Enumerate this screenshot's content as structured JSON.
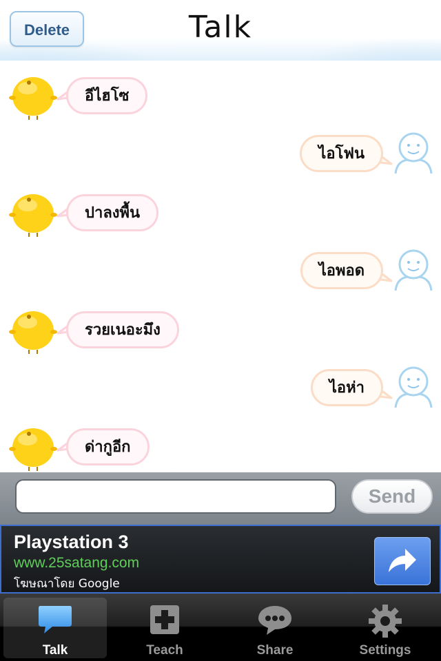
{
  "header": {
    "delete_label": "Delete",
    "title": "Talk"
  },
  "messages": [
    {
      "sender": "bot",
      "text": "อีไฮโซ"
    },
    {
      "sender": "user",
      "text": "ไอโฟน"
    },
    {
      "sender": "bot",
      "text": "ปาลงพื้น"
    },
    {
      "sender": "user",
      "text": "ไอพอด"
    },
    {
      "sender": "bot",
      "text": "รวยเนอะมึง"
    },
    {
      "sender": "user",
      "text": "ไอห่า"
    },
    {
      "sender": "bot",
      "text": "ด่ากูอีก"
    }
  ],
  "composer": {
    "input_value": "",
    "send_label": "Send"
  },
  "ad": {
    "title": "Playstation 3",
    "url": "www.25satang.com",
    "by": "โฆษณาโดย Google",
    "action_icon": "share-arrow-icon"
  },
  "tabs": [
    {
      "label": "Talk",
      "icon": "chat-bubble-icon",
      "active": true
    },
    {
      "label": "Teach",
      "icon": "plus-box-icon",
      "active": false
    },
    {
      "label": "Share",
      "icon": "speech-dots-icon",
      "active": false
    },
    {
      "label": "Settings",
      "icon": "gear-icon",
      "active": false
    }
  ],
  "colors": {
    "bot_bubble_border": "#fbd3dd",
    "user_bubble_border": "#fbdcc6",
    "ad_border": "#3b6ecf",
    "ad_url": "#5fcf5a"
  }
}
